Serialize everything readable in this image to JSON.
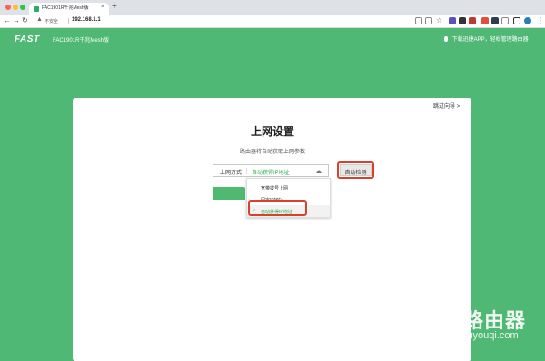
{
  "browser": {
    "tab_title": "FAC1901R千兆Mesh版",
    "tab_close": "×",
    "new_tab": "+",
    "insecure_label": "不安全",
    "url": "192.168.1.1",
    "icons": [
      "back-icon",
      "forward-icon",
      "reload-icon",
      "lock-icon",
      "share-icon",
      "star-icon",
      "extension-icon",
      "profile-icon"
    ]
  },
  "header": {
    "logo": "FAST",
    "model": "FAC1901R千兆Mesh版",
    "app_promo": "下载迅捷APP，轻松管理路由器"
  },
  "card": {
    "skip": "跳过向导 >",
    "title": "上网设置",
    "subtitle": "路由器将自动获取上网参数",
    "select_label": "上网方式",
    "select_value": "自动获得IP地址",
    "auto_detect": "自动检测",
    "options": [
      "宽带拨号上网",
      "固定IP地址",
      "自动获得IP地址"
    ],
    "selected_option_index": 2
  },
  "watermark": {
    "text": "路由器",
    "domain": "luyouqi.com"
  },
  "colors": {
    "brand_green": "#4fb874",
    "selected_text": "#2eaa4f",
    "highlight_red": "#d9412b"
  }
}
